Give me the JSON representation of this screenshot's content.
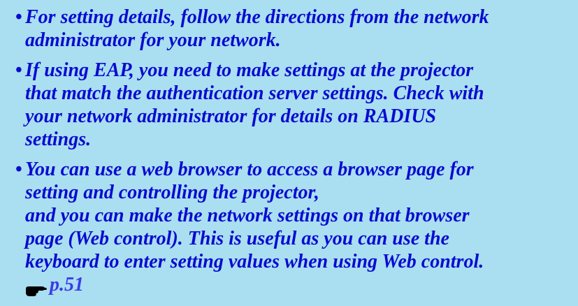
{
  "notes": [
    {
      "bullet": "•",
      "lines": [
        "For setting details, follow the directions from the network",
        "administrator for your network."
      ]
    },
    {
      "bullet": "•",
      "lines": [
        "If using EAP, you need to make settings at the projector",
        "that match the authentication server settings. Check with",
        "your network administrator for details on RADIUS",
        "settings."
      ]
    },
    {
      "bullet": "•",
      "lines": [
        "You can use a web browser to access a browser page for",
        "setting and controlling the projector,",
        "and you can make the network settings on that browser",
        "page (Web control). This is useful as you can use the",
        "keyboard to enter setting values when using Web control."
      ],
      "link": {
        "icon": "pointing-hand-icon",
        "text": "p.51"
      }
    }
  ],
  "colors": {
    "background": "#a9dff0",
    "text": "#0a0ad0",
    "link": "#3b3bea"
  }
}
